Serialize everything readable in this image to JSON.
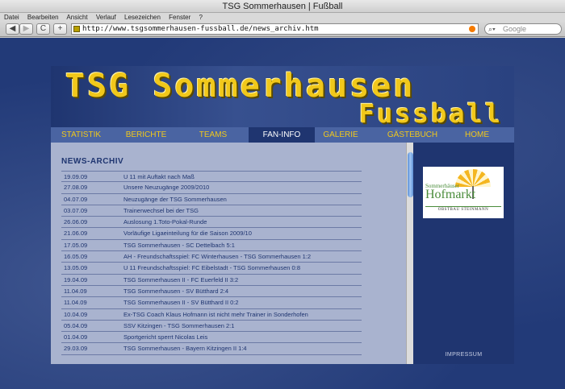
{
  "window": {
    "title": "TSG Sommerhausen | Fußball"
  },
  "menu": [
    "Datei",
    "Bearbeiten",
    "Ansicht",
    "Verlauf",
    "Lesezeichen",
    "Fenster",
    "?"
  ],
  "toolbar": {
    "url": "http://www.tsgsommerhausen-fussball.de/news_archiv.htm",
    "search_placeholder": "Google",
    "back_glyph": "◀",
    "forward_glyph": "▶",
    "reload_glyph": "C",
    "add_glyph": "+"
  },
  "site": {
    "logo_line1": "TSG Sommerhausen",
    "logo_line2": "Fussball",
    "accent_color": "#f1c81b",
    "nav": [
      "STATISTIK",
      "BERICHTE",
      "TEAMS",
      "FAN-INFO",
      "GALERIE",
      "GÄSTEBUCH",
      "HOME"
    ],
    "active_nav": "FAN-INFO"
  },
  "news": {
    "heading": "NEWS-ARCHIV",
    "rows": [
      {
        "date": "19.09.09",
        "text": "U 11 mit Auftakt nach Maß"
      },
      {
        "date": "27.08.09",
        "text": "Unsere Neuzugänge 2009/2010"
      },
      {
        "date": "04.07.09",
        "text": "Neuzugänge der TSG Sommerhausen"
      },
      {
        "date": "03.07.09",
        "text": "Trainerwechsel bei der TSG"
      },
      {
        "date": "26.06.09",
        "text": "Auslosung 1.Toto-Pokal-Runde"
      },
      {
        "date": "21.06.09",
        "text": "Vorläufige Ligaeinteilung für die Saison 2009/10"
      },
      {
        "date": "17.05.09",
        "text": "TSG Sommerhausen - SC Dettelbach 5:1"
      },
      {
        "date": "16.05.09",
        "text": "AH - Freundschaftsspiel: FC Winterhausen - TSG Sommerhausen 1:2"
      },
      {
        "date": "13.05.09",
        "text": "U 11 Freundschaftsspiel: FC Eibelstadt - TSG Sommerhausen 0:8"
      },
      {
        "date": "19.04.09",
        "text": "TSG Sommerhausen II - FC Euerfeld II 3:2"
      },
      {
        "date": "11.04.09",
        "text": "TSG Sommerhausen - SV Bütthard 2:4"
      },
      {
        "date": "11.04.09",
        "text": "TSG Sommerhausen II - SV Bütthard II 0:2"
      },
      {
        "date": "10.04.09",
        "text": "Ex-TSG Coach Klaus Hofmann ist nicht mehr Trainer in Sonderhofen"
      },
      {
        "date": "05.04.09",
        "text": "SSV Kitzingen - TSG Sommerhausen 2:1"
      },
      {
        "date": "01.04.09",
        "text": "Sportgericht sperrt Nicolas Leis"
      },
      {
        "date": "29.03.09",
        "text": "TSG Sommerhausen - Bayern Kitzingen II 1:4"
      }
    ]
  },
  "sidebar": {
    "sponsor_line1": "Sommerhäuser",
    "sponsor_line2": "Hofmarkt",
    "sponsor_line3": "OBSTBAU STEINMANN",
    "impressum": "IMPRESSUM"
  }
}
